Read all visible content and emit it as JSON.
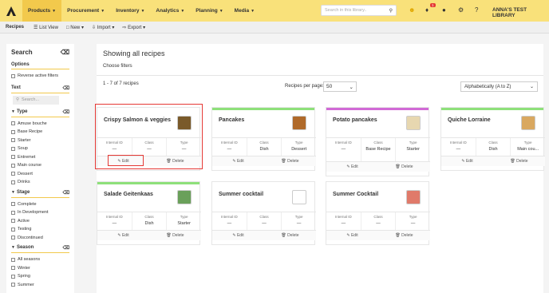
{
  "topnav": {
    "items": [
      {
        "label": "Products",
        "active": true
      },
      {
        "label": "Procurement",
        "active": false
      },
      {
        "label": "Inventory",
        "active": false
      },
      {
        "label": "Analytics",
        "active": false
      },
      {
        "label": "Planning",
        "active": false
      },
      {
        "label": "Media",
        "active": false
      }
    ],
    "search_placeholder": "Search in this library..",
    "notification_count": "1",
    "library_name": "ANNA'S TEST LIBRARY"
  },
  "subbar": {
    "title": "Recipes",
    "list_view": "List View",
    "new": "New",
    "import": "Import",
    "export": "Export"
  },
  "sidebar": {
    "title": "Search",
    "options_heading": "Options",
    "reverse_label": "Reverse active filters",
    "text_heading": "Text",
    "search_placeholder": "Search...",
    "type_heading": "Type",
    "type_options": [
      "Amuse bouche",
      "Base Recipe",
      "Starter",
      "Soup",
      "Entremet",
      "Main course",
      "Dessert",
      "Drinks"
    ],
    "stage_heading": "Stage",
    "stage_options": [
      "Complete",
      "In Development",
      "Active",
      "Testing",
      "Discontinued"
    ],
    "season_heading": "Season",
    "season_options": [
      "All seasons",
      "Winter",
      "Spring",
      "Summer"
    ]
  },
  "main": {
    "title": "Showing all recipes",
    "choose_filters": "Choose filters",
    "count": "1 - 7 of 7 recipes",
    "per_page_label": "Recipes per page:",
    "per_page_value": "50",
    "sort_value": "Alphabetically (A to Z)",
    "edit_label": "Edit",
    "delete_label": "Delete",
    "col_internal": "Internal ID",
    "col_class": "Class",
    "col_type": "Type"
  },
  "recipes": [
    {
      "name": "Crispy Salmon & veggies",
      "internal_id": "—",
      "class": "—",
      "type": "—",
      "accent": "#ffffff",
      "thumb": "#7a5a2a"
    },
    {
      "name": "Pancakes",
      "internal_id": "—",
      "class": "Dish",
      "type": "Dessert",
      "accent": "#8ee07a",
      "thumb": "#b06a2a"
    },
    {
      "name": "Potato pancakes",
      "internal_id": "—",
      "class": "Base Recipe",
      "type": "Starter",
      "accent": "#d16ad6",
      "thumb": "#e7d7b0"
    },
    {
      "name": "Quiche Lorraine",
      "internal_id": "—",
      "class": "Dish",
      "type": "Main cou...",
      "accent": "#8ee07a",
      "thumb": "#d9a860"
    },
    {
      "name": "Salade Geitenkaas",
      "internal_id": "—",
      "class": "Dish",
      "type": "Starter",
      "accent": "#8ee07a",
      "thumb": "#6aa05a"
    },
    {
      "name": "Summer cocktail",
      "internal_id": "—",
      "class": "—",
      "type": "—",
      "accent": "#ffffff",
      "thumb": "#ffffff"
    },
    {
      "name": "Summer Cocktail",
      "internal_id": "—",
      "class": "—",
      "type": "—",
      "accent": "#ffffff",
      "thumb": "#e07a6a"
    }
  ]
}
